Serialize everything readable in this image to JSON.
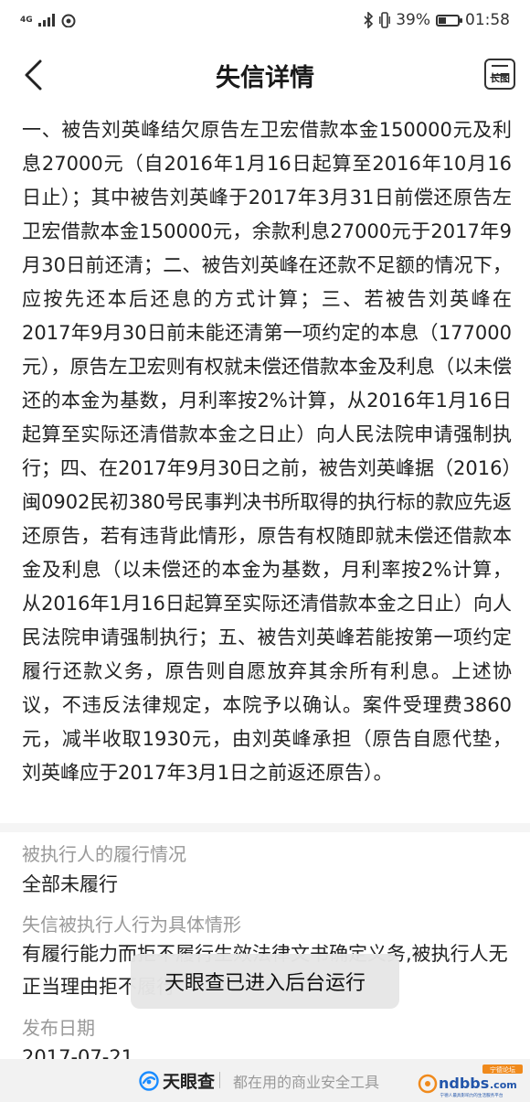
{
  "status_bar": {
    "network_label": "4G",
    "battery": "39%",
    "battery_level": 0.39,
    "time": "01:58"
  },
  "header": {
    "title": "失信详情",
    "long_image_label": "长图"
  },
  "judgment": {
    "text": "一、被告刘英峰结欠原告左卫宏借款本金150000元及利息27000元（自2016年1月16日起算至2016年10月16日止）；其中被告刘英峰于2017年3月31日前偿还原告左卫宏借款本金150000元，余款利息27000元于2017年9月30日前还清；二、被告刘英峰在还款不足额的情况下，应按先还本后还息的方式计算；三、若被告刘英峰在2017年9月30日前未能还清第一项约定的本息（177000元），原告左卫宏则有权就未偿还借款本金及利息（以未偿还的本金为基数，月利率按2%计算，从2016年1月16日起算至实际还清借款本金之日止）向人民法院申请强制执行；四、在2017年9月30日之前，被告刘英峰据（2016）闽0902民初380号民事判决书所取得的执行标的款应先返还原告，若有违背此情形，原告有权随即就未偿还借款本金及利息（以未偿还的本金为基数，月利率按2%计算，从2016年1月16日起算至实际还清借款本金之日止）向人民法院申请强制执行；五、被告刘英峰若能按第一项约定履行还款义务，原告则自愿放弃其余所有利息。上述协议，不违反法律规定，本院予以确认。案件受理费3860元，减半收取1930元，由刘英峰承担（原告自愿代垫，刘英峰应于2017年3月1日之前返还原告）。"
  },
  "fields": {
    "performance_label": "被执行人的履行情况",
    "performance_value": "全部未履行",
    "behavior_label": "失信被执行人行为具体情形",
    "behavior_value": "有履行能力而拒不履行生效法律文书确定义务,被执行人无正当理由拒不履行",
    "publish_label": "发布日期",
    "publish_value": "2017-07-21"
  },
  "toast": {
    "message": "天眼查已进入后台运行"
  },
  "bottom_bar": {
    "brand": "天眼查",
    "slogan": "都在用的商业安全工具"
  },
  "watermark": {
    "site": "ndbbs.com",
    "badge": "宁德论坛",
    "tagline": "宁德人最具影响力的生活服务平台"
  },
  "colors": {
    "brand_blue": "#1a8cff",
    "watermark_orange": "#f08a1c",
    "watermark_blue": "#2255aa"
  }
}
